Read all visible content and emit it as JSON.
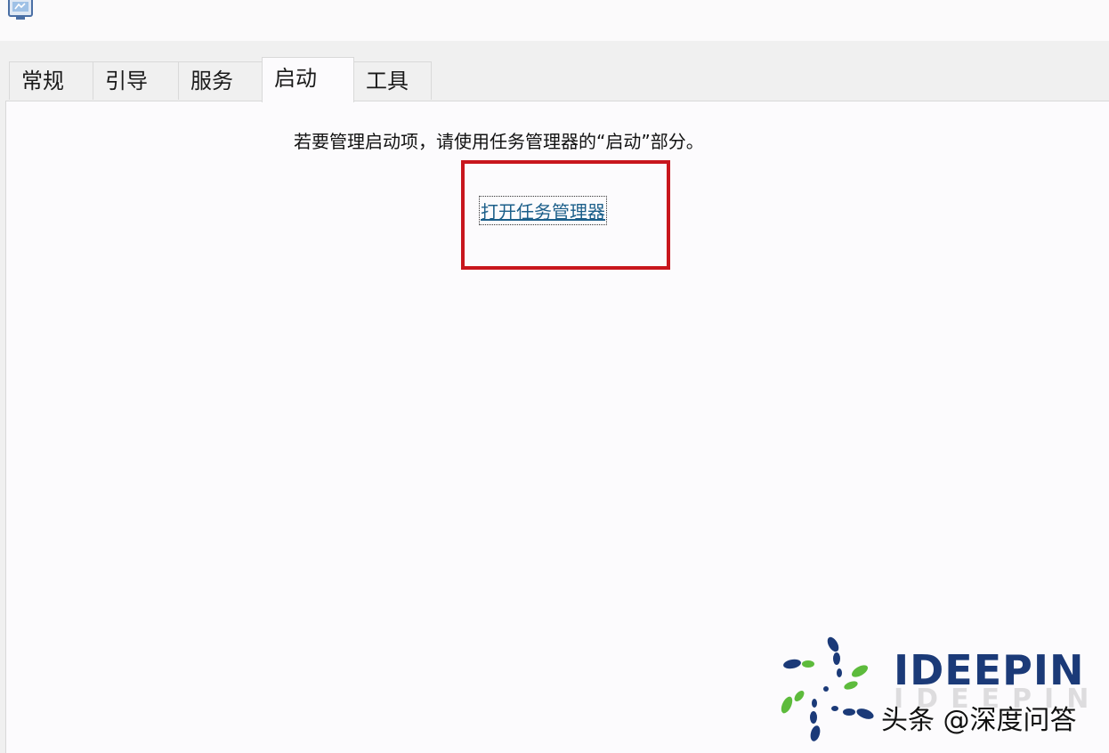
{
  "tabs": [
    {
      "label": "常规",
      "active": false
    },
    {
      "label": "引导",
      "active": false
    },
    {
      "label": "服务",
      "active": false
    },
    {
      "label": "启动",
      "active": true
    },
    {
      "label": "工具",
      "active": false
    }
  ],
  "content": {
    "instruction": "若要管理启动项，请使用任务管理器的“启动”部分。",
    "link_label": "打开任务管理器"
  },
  "watermark": {
    "brand": "IDEEPIN",
    "caption": "头条 @深度问答"
  },
  "colors": {
    "highlight": "#c8161d",
    "link": "#1c5f8a",
    "brand": "#1b3a78",
    "logo_green": "#5dbb3c",
    "logo_blue": "#1b3a78"
  },
  "icons": {
    "app": "system-config-icon"
  }
}
